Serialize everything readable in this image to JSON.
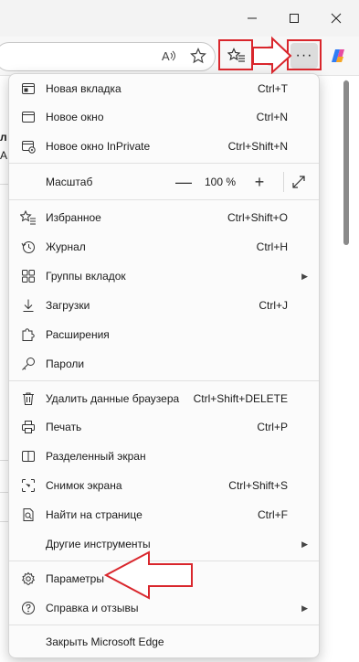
{
  "menu": {
    "items": [
      {
        "label": "Новая вкладка",
        "shortcut": "Ctrl+T"
      },
      {
        "label": "Новое окно",
        "shortcut": "Ctrl+N"
      },
      {
        "label": "Новое окно InPrivate",
        "shortcut": "Ctrl+Shift+N"
      },
      {
        "label": "Избранное",
        "shortcut": "Ctrl+Shift+O"
      },
      {
        "label": "Журнал",
        "shortcut": "Ctrl+H"
      },
      {
        "label": "Группы вкладок",
        "shortcut": ""
      },
      {
        "label": "Загрузки",
        "shortcut": "Ctrl+J"
      },
      {
        "label": "Расширения",
        "shortcut": ""
      },
      {
        "label": "Пароли",
        "shortcut": ""
      },
      {
        "label": "Удалить данные браузера",
        "shortcut": "Ctrl+Shift+DELETE"
      },
      {
        "label": "Печать",
        "shortcut": "Ctrl+P"
      },
      {
        "label": "Разделенный экран",
        "shortcut": ""
      },
      {
        "label": "Снимок экрана",
        "shortcut": "Ctrl+Shift+S"
      },
      {
        "label": "Найти на странице",
        "shortcut": "Ctrl+F"
      },
      {
        "label": "Другие инструменты",
        "shortcut": ""
      },
      {
        "label": "Параметры",
        "shortcut": ""
      },
      {
        "label": "Справка и отзывы",
        "shortcut": ""
      },
      {
        "label": "Закрыть Microsoft Edge",
        "shortcut": ""
      }
    ],
    "zoom": {
      "label": "Масштаб",
      "value": "100 %",
      "minus": "—",
      "plus": "+"
    }
  },
  "toolbar": {
    "more_label": "···"
  },
  "page": {
    "snippet1": "л",
    "snippet2": "А"
  },
  "colors": {
    "annotation": "#d9262c",
    "accent": "#0067c0"
  }
}
